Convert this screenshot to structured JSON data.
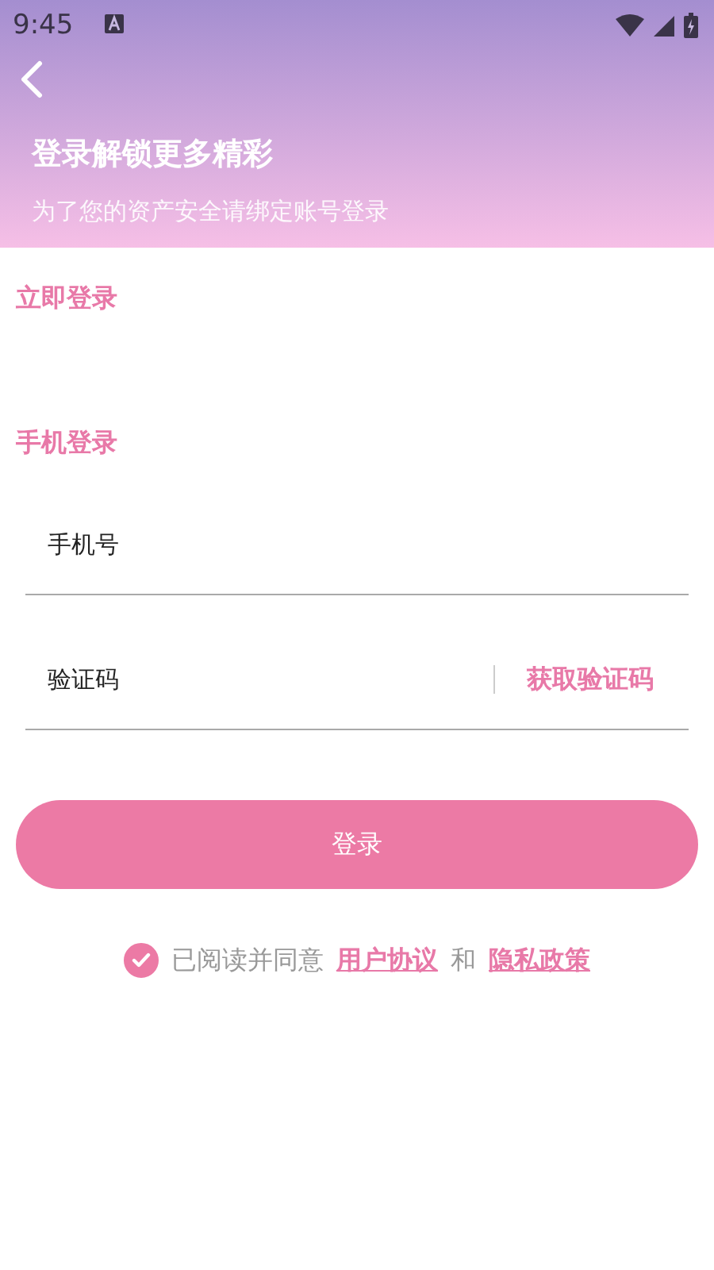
{
  "status_bar": {
    "time": "9:45"
  },
  "header": {
    "title": "登录解锁更多精彩",
    "subtitle": "为了您的资产安全请绑定账号登录"
  },
  "section_title": "立即登录",
  "phone_login": {
    "title": "手机登录",
    "phone_field": {
      "placeholder": "手机号"
    },
    "code_field": {
      "placeholder": "验证码"
    },
    "get_code_link": "获取验证码"
  },
  "login_button": "登录",
  "agreement": {
    "checked": true,
    "text": "已阅读并同意",
    "link_1": "用户协议",
    "conjunction": "和",
    "link_2": "隐私政策"
  }
}
